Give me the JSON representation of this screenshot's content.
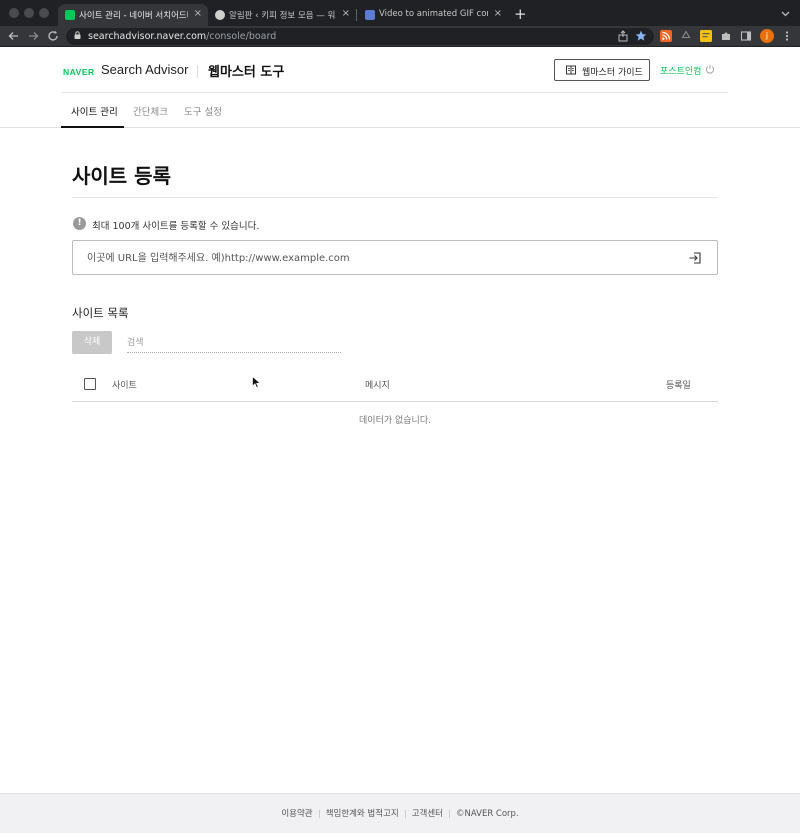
{
  "browser": {
    "tabs": [
      {
        "title": "사이트 관리 - 네이버 서치어드바이저",
        "favicon_color": "#03c75a",
        "active": true
      },
      {
        "title": "알림판 ‹ 키피 정보 모음 — 워드프레",
        "favicon_color": "#cfcfcf",
        "active": false
      },
      {
        "title": "Video to animated GIF converter",
        "favicon_color": "#5b7bd5",
        "active": false
      }
    ],
    "close_glyph": "×",
    "new_tab_glyph": "+",
    "url_host": "searchadvisor.naver.com",
    "url_path": "/console/board",
    "profile_initial": "j"
  },
  "header": {
    "brand_naver": "NAVER",
    "brand_name": "Search Advisor",
    "section_title": "웹마스터 도구",
    "guide_button": "웹마스터 가이드",
    "login_link": "포스트인컴"
  },
  "subnav": {
    "tabs": [
      {
        "label": "사이트 관리",
        "active": true
      },
      {
        "label": "간단체크",
        "active": false
      },
      {
        "label": "도구 설정",
        "active": false
      }
    ]
  },
  "main": {
    "title": "사이트 등록",
    "notice_icon": "!",
    "notice": "최대 100개 사이트를 등록할 수 있습니다.",
    "url_input": {
      "value": "",
      "placeholder": "이곳에 URL을 입력해주세요. 예)http://www.example.com"
    },
    "list_title": "사이트 목록",
    "delete_button": "삭제",
    "search_input": {
      "value": "",
      "placeholder": "검색"
    },
    "table": {
      "columns": [
        "사이트",
        "메시지",
        "등록일"
      ],
      "rows": [],
      "empty_text": "데이터가 없습니다."
    }
  },
  "footer": {
    "links": [
      "이용약관",
      "책임한계와 법적고지",
      "고객센터",
      "©NAVER Corp."
    ]
  },
  "colors": {
    "brand_green": "#03c75a",
    "chrome_dark": "#202124",
    "chrome_toolbar": "#35363a",
    "star_blue": "#8ab4f8"
  }
}
